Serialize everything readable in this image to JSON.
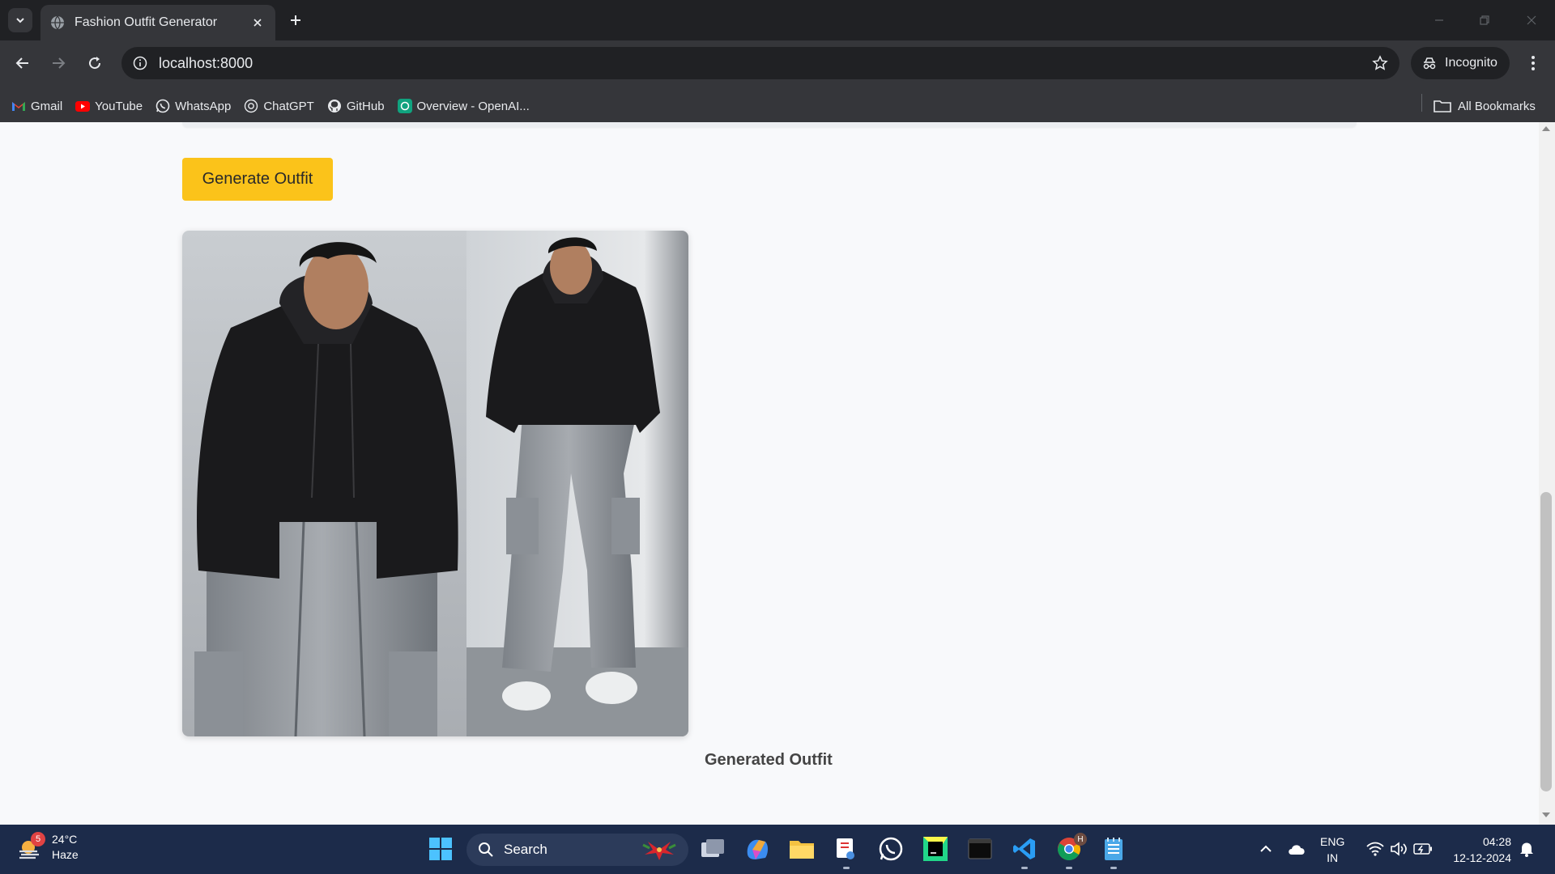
{
  "browser": {
    "tab_title": "Fashion Outfit Generator",
    "url": "localhost:8000",
    "incognito_label": "Incognito",
    "bookmarks": [
      {
        "label": "Gmail",
        "icon": "gmail-icon"
      },
      {
        "label": "YouTube",
        "icon": "youtube-icon"
      },
      {
        "label": "WhatsApp",
        "icon": "whatsapp-icon"
      },
      {
        "label": "ChatGPT",
        "icon": "chatgpt-icon"
      },
      {
        "label": "GitHub",
        "icon": "github-icon"
      },
      {
        "label": "Overview - OpenAI...",
        "icon": "openai-icon"
      }
    ],
    "all_bookmarks_label": "All Bookmarks"
  },
  "page": {
    "generate_button_label": "Generate Outfit",
    "image_alt": "Generated outfit image: man in black hoodie and grey cargo pants",
    "caption": "Generated Outfit"
  },
  "taskbar": {
    "weather_temp": "24°C",
    "weather_desc": "Haze",
    "weather_badge": "5",
    "search_label": "Search",
    "lang_line1": "ENG",
    "lang_line2": "IN",
    "time": "04:28",
    "date": "12-12-2024",
    "chrome_badge": "H"
  },
  "colors": {
    "accent_button": "#fbc31a",
    "chrome_dark": "#202124",
    "chrome_toolbar": "#35363a",
    "taskbar": "#1c2b4a"
  }
}
